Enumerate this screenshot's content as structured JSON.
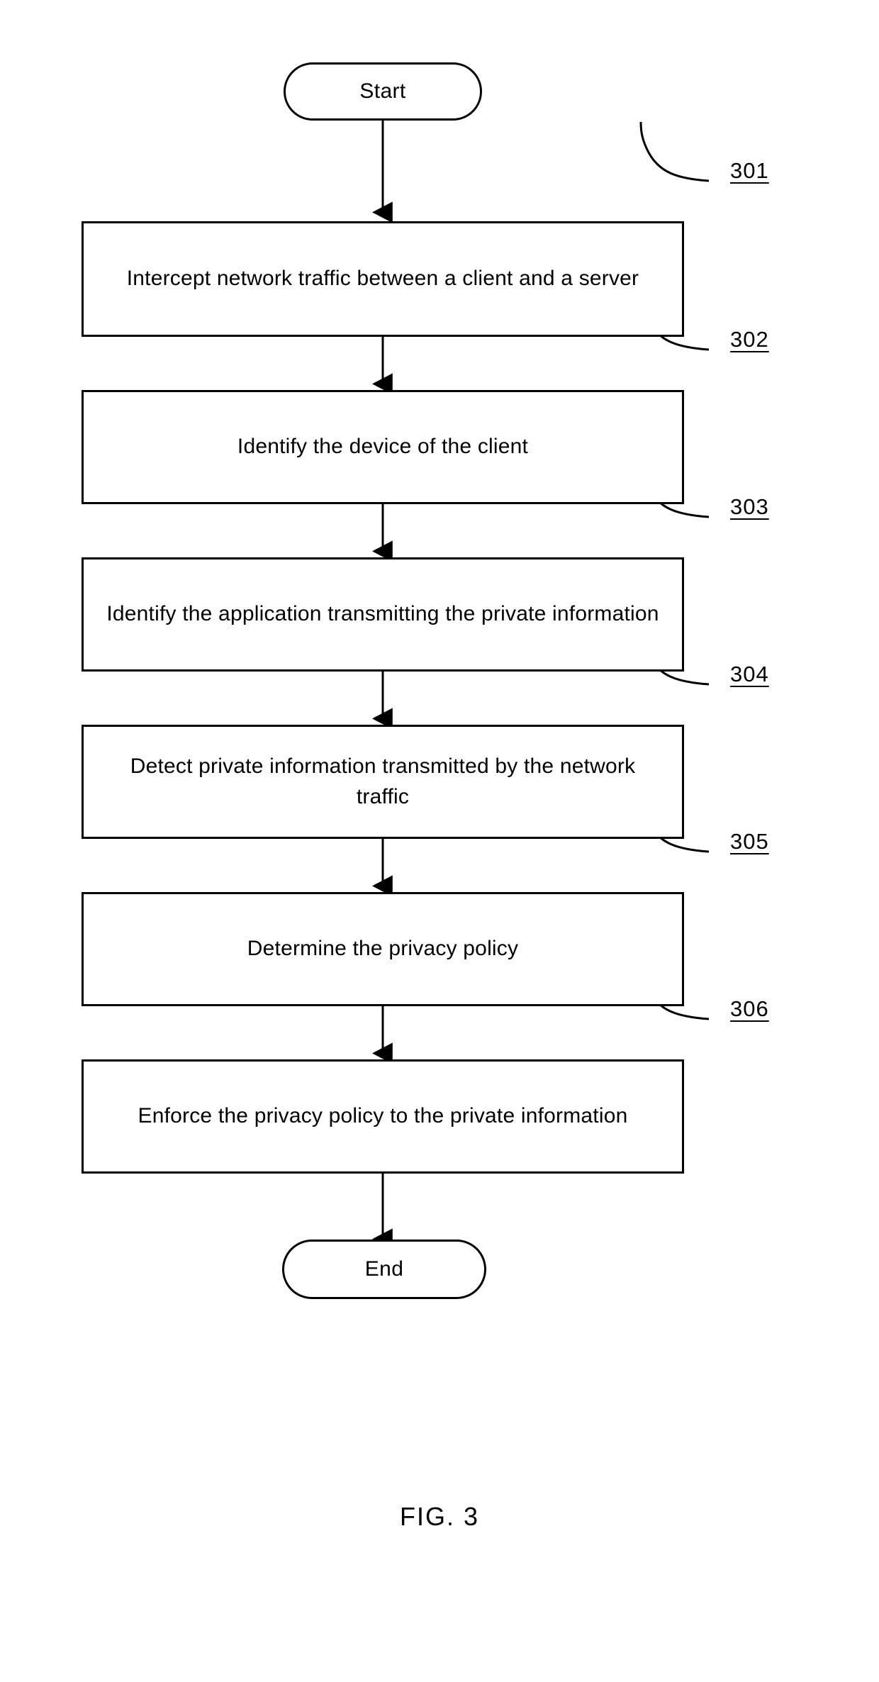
{
  "figure": {
    "caption": "FIG. 3",
    "type": "flowchart",
    "orientation": "vertical-top-to-bottom"
  },
  "nodes": [
    {
      "id": "start",
      "shape": "terminal",
      "label": "Start",
      "ref": null
    },
    {
      "id": "step-301",
      "shape": "process",
      "label": "Intercept network traffic between a client and a server",
      "ref": "301"
    },
    {
      "id": "step-302",
      "shape": "process",
      "label": "Identify the device of the client",
      "ref": "302"
    },
    {
      "id": "step-303",
      "shape": "process",
      "label": "Identify the application transmitting the private information",
      "ref": "303"
    },
    {
      "id": "step-304",
      "shape": "process",
      "label": "Detect private information transmitted by the network traffic",
      "ref": "304"
    },
    {
      "id": "step-305",
      "shape": "process",
      "label": "Determine the privacy policy",
      "ref": "305"
    },
    {
      "id": "step-306",
      "shape": "process",
      "label": "Enforce the privacy policy to the private information",
      "ref": "306"
    },
    {
      "id": "end",
      "shape": "terminal",
      "label": "End",
      "ref": null
    }
  ],
  "reference_numerals": {
    "n301": "301",
    "n302": "302",
    "n303": "303",
    "n304": "304",
    "n305": "305",
    "n306": "306"
  },
  "labels": {
    "start": "Start",
    "end": "End",
    "step301": "Intercept network traffic between a client and a server",
    "step302": "Identify the device of the client",
    "step303": "Identify the application transmitting the private information",
    "step304": "Detect private information transmitted by the network traffic",
    "step305": "Determine the privacy policy",
    "step306": "Enforce the privacy policy to the private information"
  },
  "colors": {
    "stroke": "#000000",
    "fill": "#ffffff",
    "text": "#000000"
  }
}
